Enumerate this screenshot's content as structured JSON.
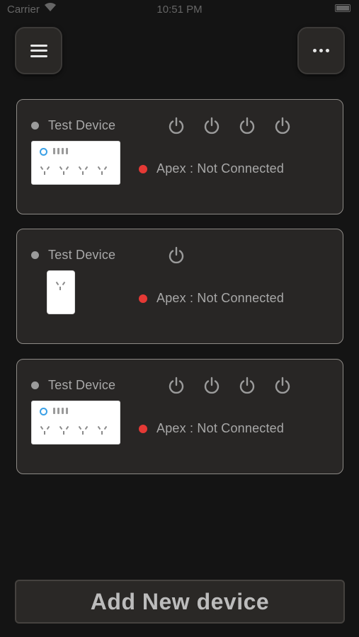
{
  "status_bar": {
    "carrier": "Carrier",
    "time": "10:51 PM"
  },
  "header": {
    "menu_icon": "hamburger-icon",
    "more_icon": "more-dots-icon"
  },
  "devices": [
    {
      "name": "Test Device",
      "type": "power-strip",
      "outlets": 4,
      "status_label": "Apex : Not Connected",
      "status_color": "#e53935"
    },
    {
      "name": "Test Device",
      "type": "single-plug",
      "outlets": 1,
      "status_label": "Apex : Not Connected",
      "status_color": "#e53935"
    },
    {
      "name": "Test Device",
      "type": "power-strip",
      "outlets": 4,
      "status_label": "Apex : Not Connected",
      "status_color": "#e53935"
    }
  ],
  "footer": {
    "add_label": "Add New device"
  }
}
